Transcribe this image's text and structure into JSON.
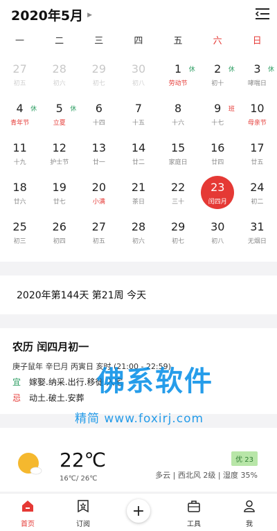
{
  "header": {
    "title": "2020年5月"
  },
  "weekdays": [
    "一",
    "二",
    "三",
    "四",
    "五",
    "六",
    "日"
  ],
  "calendar": [
    {
      "day": "27",
      "sub": "初五",
      "other": true
    },
    {
      "day": "28",
      "sub": "初六",
      "other": true
    },
    {
      "day": "29",
      "sub": "初七",
      "other": true
    },
    {
      "day": "30",
      "sub": "初八",
      "other": true
    },
    {
      "day": "1",
      "sub": "劳动节",
      "red": true,
      "tag": "休",
      "tagType": "rest"
    },
    {
      "day": "2",
      "sub": "初十",
      "tag": "休",
      "tagType": "rest"
    },
    {
      "day": "3",
      "sub": "哮喘日",
      "tag": "休",
      "tagType": "rest"
    },
    {
      "day": "4",
      "sub": "青年节",
      "red": true,
      "tag": "休",
      "tagType": "rest"
    },
    {
      "day": "5",
      "sub": "立夏",
      "red": true,
      "tag": "休",
      "tagType": "rest"
    },
    {
      "day": "6",
      "sub": "十四"
    },
    {
      "day": "7",
      "sub": "十五"
    },
    {
      "day": "8",
      "sub": "十六"
    },
    {
      "day": "9",
      "sub": "十七",
      "tag": "班",
      "tagType": "work"
    },
    {
      "day": "10",
      "sub": "母亲节",
      "red": true
    },
    {
      "day": "11",
      "sub": "十九"
    },
    {
      "day": "12",
      "sub": "护士节"
    },
    {
      "day": "13",
      "sub": "廿一"
    },
    {
      "day": "14",
      "sub": "廿二"
    },
    {
      "day": "15",
      "sub": "家庭日"
    },
    {
      "day": "16",
      "sub": "廿四"
    },
    {
      "day": "17",
      "sub": "廿五"
    },
    {
      "day": "18",
      "sub": "廿六"
    },
    {
      "day": "19",
      "sub": "廿七"
    },
    {
      "day": "20",
      "sub": "小满",
      "red": true
    },
    {
      "day": "21",
      "sub": "茶日"
    },
    {
      "day": "22",
      "sub": "三十"
    },
    {
      "day": "23",
      "sub": "闰四月",
      "today": true
    },
    {
      "day": "24",
      "sub": "初二"
    },
    {
      "day": "25",
      "sub": "初三"
    },
    {
      "day": "26",
      "sub": "初四"
    },
    {
      "day": "27",
      "sub": "初五"
    },
    {
      "day": "28",
      "sub": "初六"
    },
    {
      "day": "29",
      "sub": "初七"
    },
    {
      "day": "30",
      "sub": "初八"
    },
    {
      "day": "31",
      "sub": "无烟日"
    }
  ],
  "daycount": "2020年第144天 第21周 今天",
  "lunar": {
    "title": "农历 闰四月初一",
    "ganzhi": "庚子鼠年 辛巳月 丙寅日 亥时 (21:00 - 22:59)",
    "yi_label": "宜",
    "yi": "嫁娶.纳采.出行.移徙.入宅",
    "ji_label": "忌",
    "ji": "动土.破土.安葬"
  },
  "watermark": {
    "main": "佛系软件",
    "sub": "精简 www.foxirj.com"
  },
  "weather": {
    "temp": "22℃",
    "range": "16℃/ 26℃",
    "aqi": "优 23",
    "desc": "多云 | 西北风 2级 | 湿度 35%"
  },
  "tabs": [
    {
      "label": "首页",
      "icon": "home-icon",
      "active": true
    },
    {
      "label": "订阅",
      "icon": "subscribe-icon"
    },
    {
      "label": "",
      "icon": "add-icon"
    },
    {
      "label": "工具",
      "icon": "toolbox-icon"
    },
    {
      "label": "我",
      "icon": "user-icon"
    }
  ],
  "colors": {
    "accent": "#e53935",
    "rest": "#2e9e63"
  }
}
